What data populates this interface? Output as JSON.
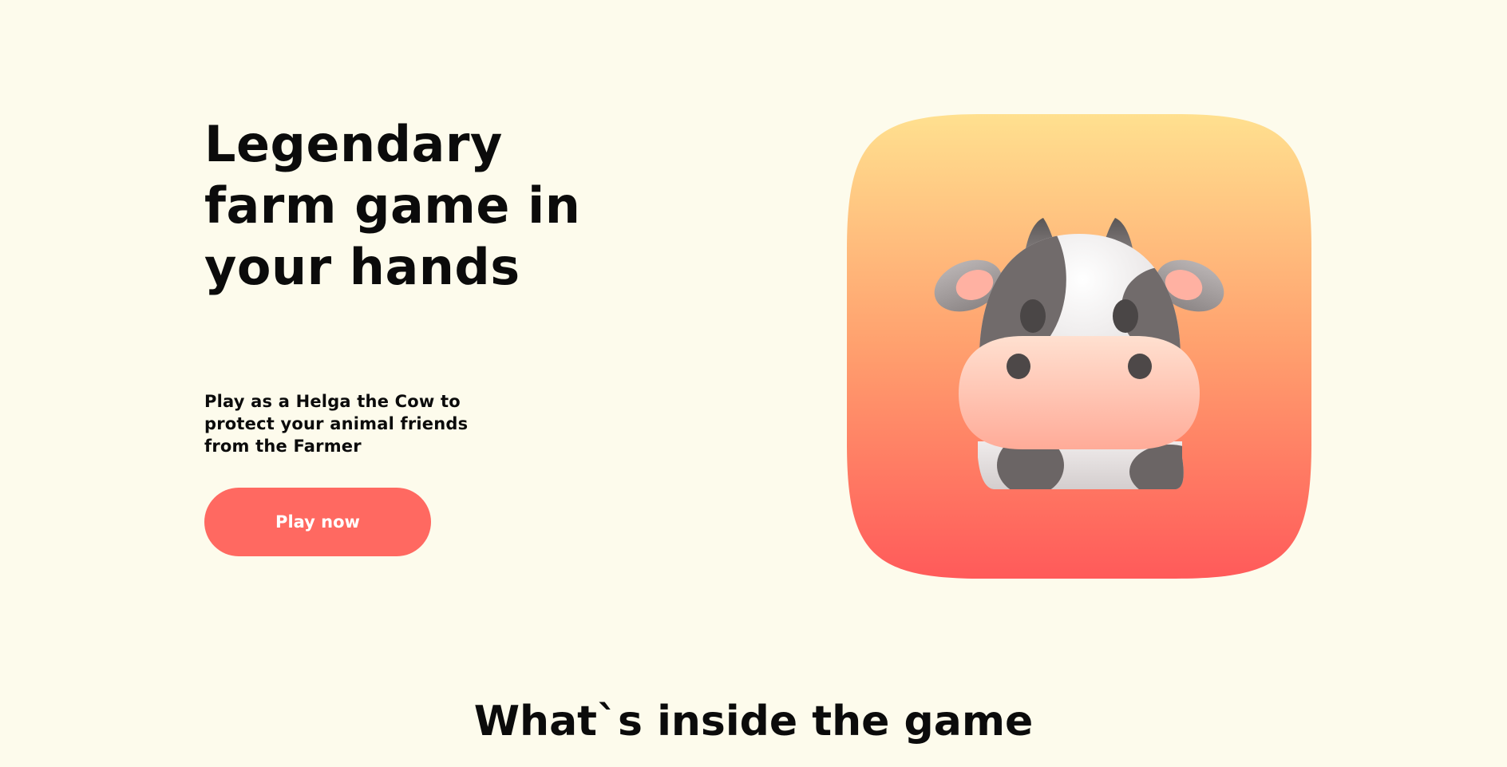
{
  "hero": {
    "title": "Legendary farm game in your hands",
    "subtitle": "Play as a Helga the Cow to protect your animal friends from the Farmer",
    "cta_label": "Play now"
  },
  "app_icon": {
    "icon": "cow-icon",
    "gradient_top": "#ffe08f",
    "gradient_bottom": "#ff5a5a"
  },
  "features": {
    "title": "What`s inside the game"
  },
  "colors": {
    "background": "#fdfbec",
    "accent": "#ff6961",
    "text": "#0b0b0b"
  }
}
